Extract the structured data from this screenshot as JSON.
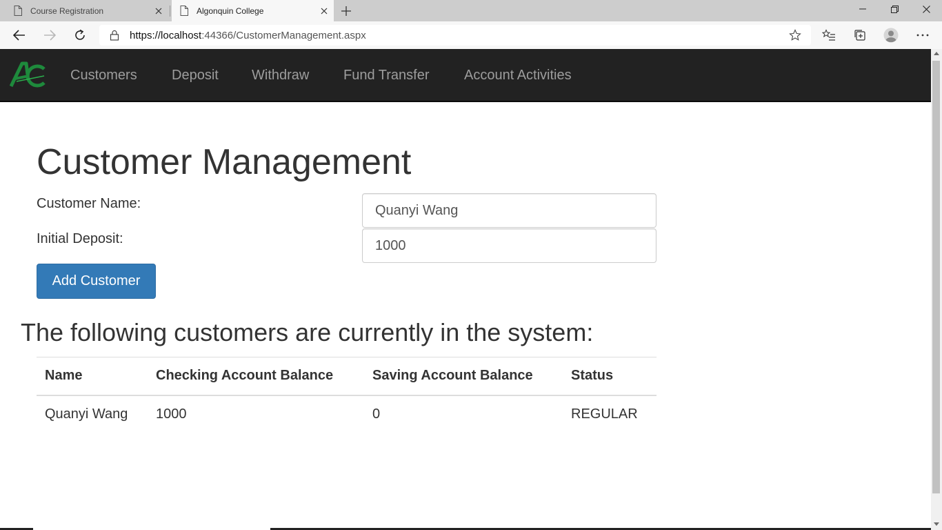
{
  "browser": {
    "tabs": [
      {
        "label": "Course Registration",
        "active": false
      },
      {
        "label": "Algonquin College",
        "active": true
      }
    ],
    "url": "https://localhost:44366/CustomerManagement.aspx",
    "url_host": "https://localhost",
    "url_rest": ":44366/CustomerManagement.aspx"
  },
  "navbar": {
    "brand_text": "AC",
    "links": [
      "Customers",
      "Deposit",
      "Withdraw",
      "Fund Transfer",
      "Account Activities"
    ]
  },
  "main": {
    "title": "Customer Management",
    "form": {
      "name_label": "Customer Name:",
      "name_value": "Quanyi Wang",
      "deposit_label": "Initial Deposit:",
      "deposit_value": "1000",
      "submit_label": "Add Customer"
    },
    "list_heading": "The following customers are currently in the system:",
    "table": {
      "headers": [
        "Name",
        "Checking Account Balance",
        "Saving Account Balance",
        "Status"
      ],
      "rows": [
        [
          "Quanyi Wang",
          "1000",
          "0",
          "REGULAR"
        ]
      ]
    }
  },
  "colors": {
    "navbar_bg": "#222222",
    "nav_link": "#9d9d9d",
    "primary_button": "#337ab7",
    "brand_green": "#1e8a3c"
  }
}
